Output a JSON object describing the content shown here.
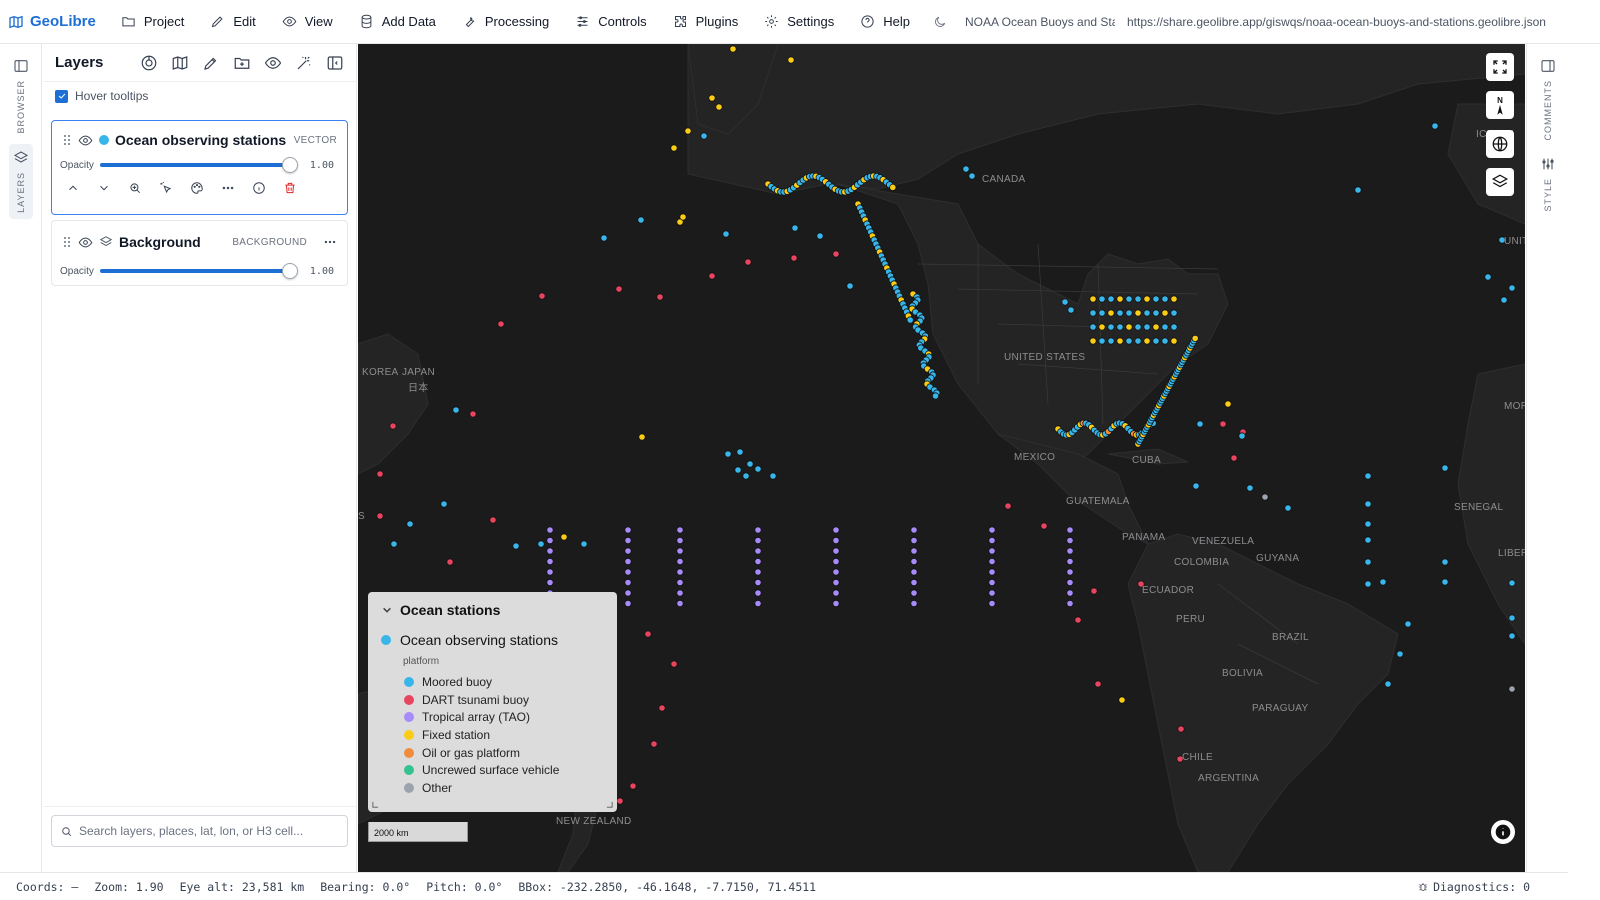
{
  "app": {
    "name": "GeoLibre",
    "project_title": "NOAA Ocean Buoys and Stations",
    "share_url": "https://share.geolibre.app/giswqs/noaa-ocean-buoys-and-stations.geolibre.json"
  },
  "menu": [
    {
      "label": "Project",
      "icon": "folder-icon"
    },
    {
      "label": "Edit",
      "icon": "pencil-icon"
    },
    {
      "label": "View",
      "icon": "eye-icon"
    },
    {
      "label": "Add Data",
      "icon": "database-icon"
    },
    {
      "label": "Processing",
      "icon": "wrench-icon"
    },
    {
      "label": "Controls",
      "icon": "sliders-icon"
    },
    {
      "label": "Plugins",
      "icon": "puzzle-icon"
    },
    {
      "label": "Settings",
      "icon": "gear-icon"
    },
    {
      "label": "Help",
      "icon": "help-circle-icon"
    }
  ],
  "left_rail": {
    "browser_label": "BROWSER",
    "layers_label": "LAYERS"
  },
  "right_rail": {
    "comments_label": "COMMENTS",
    "style_label": "STYLE"
  },
  "layers_panel": {
    "title": "Layers",
    "hover_tooltips_label": "Hover tooltips",
    "hover_tooltips_checked": true,
    "search_placeholder": "Search layers, places, lat, lon, or H3 cell...",
    "layers": [
      {
        "name": "Ocean observing stations",
        "type": "VECTOR",
        "opacity_label": "Opacity",
        "opacity": "1.00",
        "color": "#38b6ea",
        "selected": true
      },
      {
        "name": "Background",
        "type": "BACKGROUND",
        "opacity_label": "Opacity",
        "opacity": "1.00",
        "selected": false
      }
    ]
  },
  "map": {
    "labels": {
      "canada": "CANADA",
      "united_states": "UNITED STATES",
      "mexico": "MEXICO",
      "cuba": "CUBA",
      "guatemala": "GUATEMALA",
      "panama": "PANAMA",
      "venezuela": "VENEZUELA",
      "guyana": "GUYANA",
      "colombia": "COLOMBIA",
      "ecuador": "ECUADOR",
      "peru": "PERU",
      "brazil": "BRAZIL",
      "bolivia": "BOLIVIA",
      "paraguay": "PARAGUAY",
      "chile": "CHILE",
      "argentina": "ARGENTINA",
      "korea": "KOREA",
      "japan": "JAPAN",
      "japan_native": "日本",
      "new_zealand": "NEW ZEALAND",
      "iceland": "ICELAN",
      "senegal": "SENEGAL",
      "liberia": "LIBER",
      "morocco": "MOR",
      "uk": "UNIT",
      "s_edge": "S"
    },
    "compass_label": "N",
    "scale_label": "2000 km",
    "legend": {
      "title": "Ocean stations",
      "layer_name": "Ocean observing stations",
      "field": "platform",
      "items": [
        {
          "label": "Moored buoy",
          "color": "#38b6ea"
        },
        {
          "label": "DART tsunami buoy",
          "color": "#e8435f"
        },
        {
          "label": "Tropical array (TAO)",
          "color": "#a78bfa"
        },
        {
          "label": "Fixed station",
          "color": "#facc15"
        },
        {
          "label": "Oil or gas platform",
          "color": "#f08c3c"
        },
        {
          "label": "Uncrewed surface vehicle",
          "color": "#34c38f"
        },
        {
          "label": "Other",
          "color": "#9ca3af"
        }
      ]
    }
  },
  "status": {
    "coords": "Coords: —",
    "zoom": "Zoom: 1.90",
    "eye_alt": "Eye alt: 23,581 km",
    "bearing": "Bearing: 0.0°",
    "pitch": "Pitch: 0.0°",
    "bbox": "BBox: -232.2850, -46.1648, -7.7150, 71.4511",
    "diagnostics": "Diagnostics: 0"
  }
}
